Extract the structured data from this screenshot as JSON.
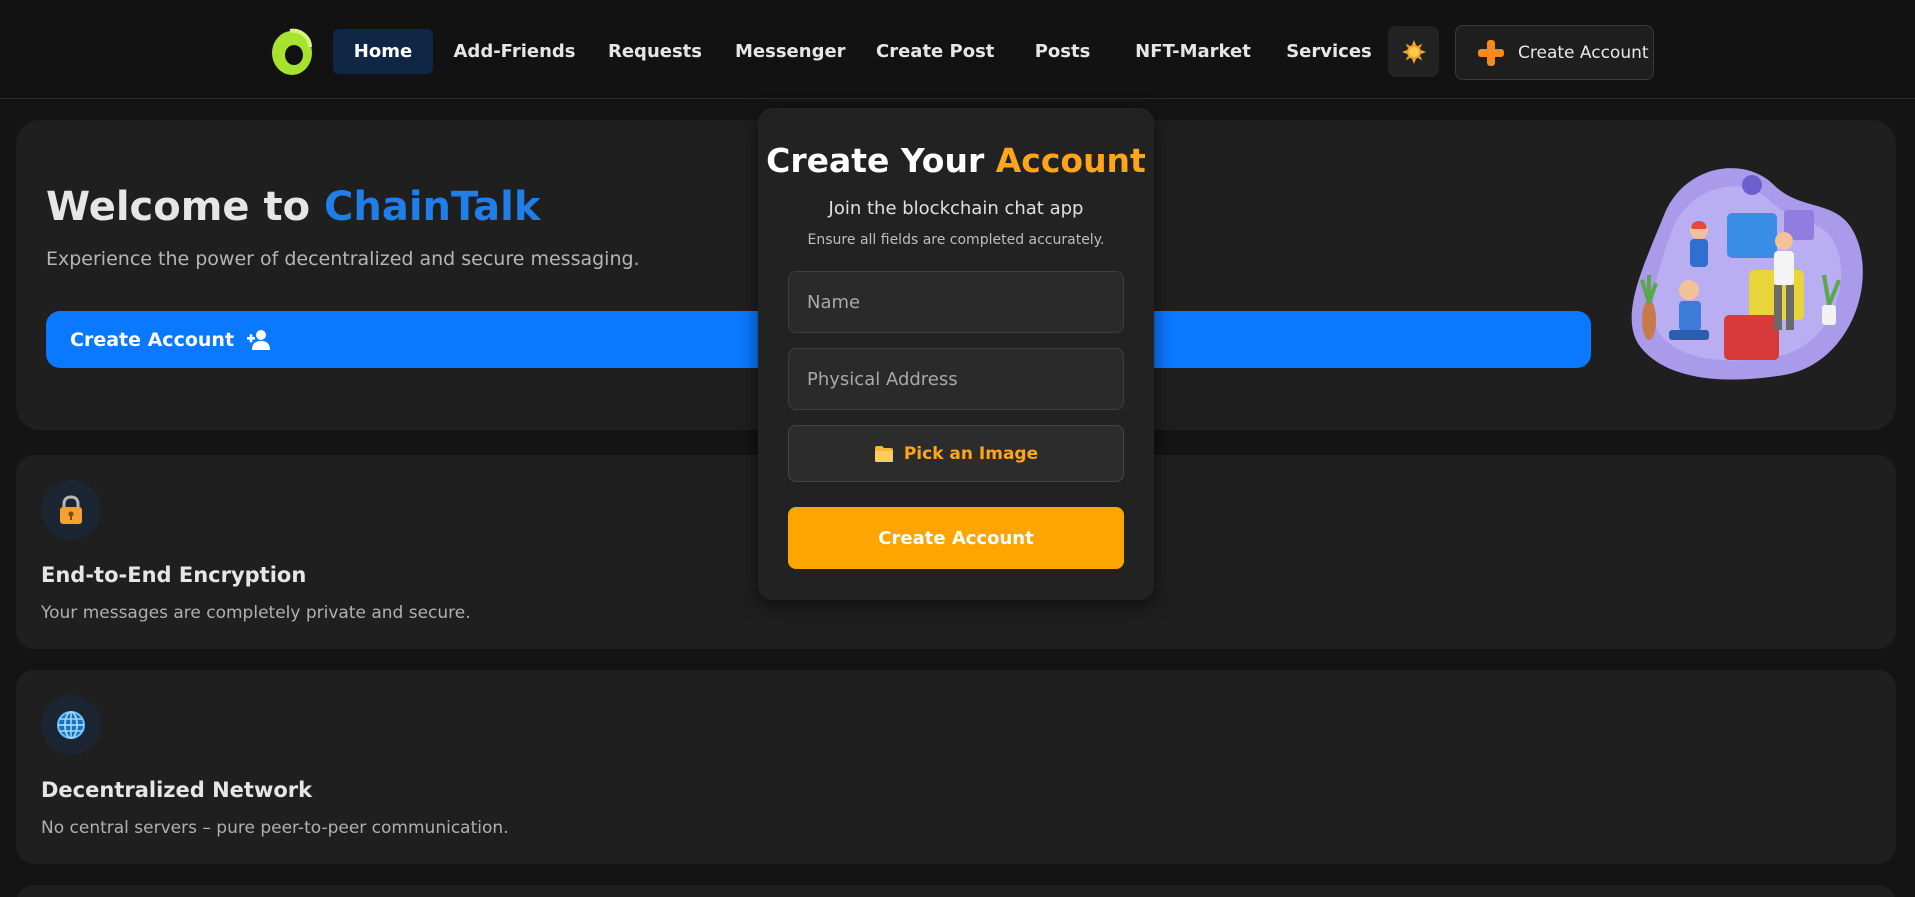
{
  "nav": {
    "items": [
      {
        "label": "Home",
        "active": true
      },
      {
        "label": "Add-Friends",
        "active": false
      },
      {
        "label": "Requests",
        "active": false
      },
      {
        "label": "Messenger",
        "active": false
      },
      {
        "label": "Create Post",
        "active": false
      },
      {
        "label": "Posts",
        "active": false
      },
      {
        "label": "NFT-Market",
        "active": false
      },
      {
        "label": "Services",
        "active": false
      }
    ],
    "create_account_label": "Create Account",
    "theme_icon": "sun-icon",
    "logo_icon": "chaintalk-logo"
  },
  "hero": {
    "title_prefix": "Welcome to ",
    "title_brand": "ChainTalk",
    "subtitle": "Experience the power of decentralized and secure messaging.",
    "button_label": "Create Account",
    "button_icon": "user-plus-icon"
  },
  "features": [
    {
      "icon": "lock-icon",
      "title": "End-to-End Encryption",
      "desc": "Your messages are completely private and secure."
    },
    {
      "icon": "globe-icon",
      "title": "Decentralized Network",
      "desc": "No central servers – pure peer-to-peer communication."
    }
  ],
  "modal": {
    "title_prefix": "Create Your ",
    "title_accent": "Account",
    "subtitle": "Join the blockchain chat app",
    "hint": "Ensure all fields are completed accurately.",
    "name_placeholder": "Name",
    "address_placeholder": "Physical Address",
    "pick_image_label": "Pick an Image",
    "submit_label": "Create Account"
  },
  "colors": {
    "brand_blue": "#0a78ff",
    "accent_orange": "#ffa500",
    "background": "#141414",
    "card": "#1f1f1f"
  }
}
